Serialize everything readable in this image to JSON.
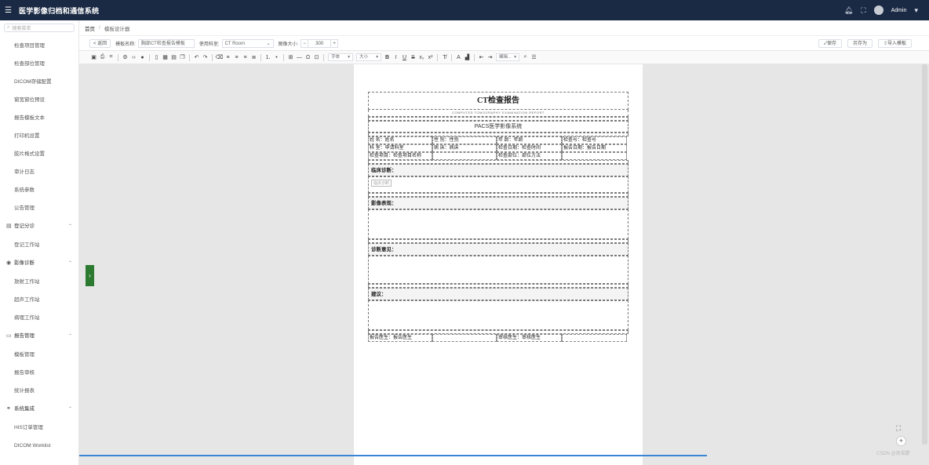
{
  "app": {
    "title": "医学影像归档和通信系统",
    "user": "Admin"
  },
  "sidebar": {
    "search_placeholder": "搜索菜单",
    "items": [
      {
        "type": "item",
        "label": "检查项目管理"
      },
      {
        "type": "item",
        "label": "检查部位管理"
      },
      {
        "type": "item",
        "label": "DICOM存储配置"
      },
      {
        "type": "item",
        "label": "窗宽窗位预设"
      },
      {
        "type": "item",
        "label": "报告模板文本"
      },
      {
        "type": "item",
        "label": "打印机设置"
      },
      {
        "type": "item",
        "label": "胶片格式设置"
      },
      {
        "type": "item",
        "label": "审计日志"
      },
      {
        "type": "item",
        "label": "系统参数"
      },
      {
        "type": "item",
        "label": "公告管理"
      },
      {
        "type": "group",
        "label": "登记分诊",
        "icon": "clipboard-icon"
      },
      {
        "type": "item",
        "label": "登记工作站"
      },
      {
        "type": "group",
        "label": "影像诊断",
        "icon": "eye-icon"
      },
      {
        "type": "item",
        "label": "放射工作站"
      },
      {
        "type": "item",
        "label": "超声工作站"
      },
      {
        "type": "item",
        "label": "病理工作站"
      },
      {
        "type": "group",
        "label": "报告管理",
        "icon": "document-icon"
      },
      {
        "type": "item",
        "label": "模板管理"
      },
      {
        "type": "item",
        "label": "报告审核"
      },
      {
        "type": "item",
        "label": "统计报表"
      },
      {
        "type": "group",
        "label": "系统集成",
        "icon": "link-icon"
      },
      {
        "type": "item",
        "label": "HIS订单管理"
      },
      {
        "type": "item",
        "label": "DICOM Worklist"
      }
    ]
  },
  "breadcrumb": {
    "home": "首页",
    "current": "模板设计器"
  },
  "toolbar": {
    "back_label": "< 返回",
    "template_name_label": "模板名称:",
    "template_name_value": "胸部CT检查报告模板",
    "dept_label": "使用科室:",
    "dept_value": "CT Room",
    "font_size_label": "图像大小:",
    "font_size_minus": "−",
    "font_size_value": "300",
    "font_size_plus": "+",
    "save_label": "✓保存",
    "save_as_label": "另存为",
    "import_label": "⇪导入模板"
  },
  "editor_toolbar": {
    "font_family": "字体",
    "font_size": "大小",
    "edit_menu": "编辑..."
  },
  "template": {
    "title": "CT检查报告",
    "subtitle_en": "COMPUTED TOMOGRAPHY EXAMINATION REPORT",
    "hospital": "PACS医学影像系统",
    "info_rows": [
      [
        "姓 名：姓名",
        "性 别：性别",
        "年 龄：年龄",
        "检查号：检查号"
      ],
      [
        "科 室：申请科室",
        "病 床：病床",
        "检查日期：检查时间",
        "报告日期：报告日期"
      ],
      [
        "检查项目：检查项目名称",
        "",
        "检查部位：部位方法",
        ""
      ]
    ],
    "sections": [
      {
        "heading": "临床诊断：",
        "placeholder": "临床诊断"
      },
      {
        "heading": "影像表现：",
        "placeholder": ""
      },
      {
        "heading": "诊断意见：",
        "placeholder": ""
      },
      {
        "heading": "建议：",
        "placeholder": ""
      }
    ],
    "signature_row": [
      "报告医生：报告医生",
      "",
      "审核医生：审核医生",
      ""
    ]
  },
  "watermark": "CSDN @周福蒙"
}
